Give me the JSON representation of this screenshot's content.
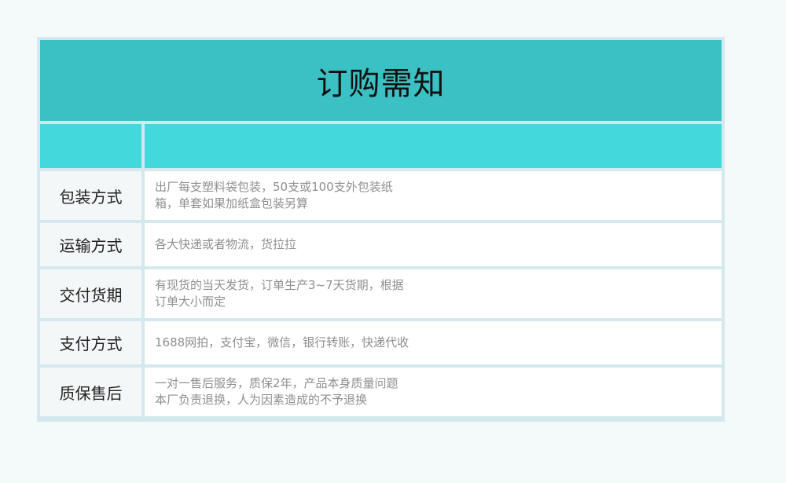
{
  "title": "订购需知",
  "rows": [
    {
      "label": "包装方式",
      "lines": [
        "出厂每支塑料袋包装，50支或100支外包装纸",
        "箱，单套如果加纸盒包装另算"
      ]
    },
    {
      "label": "运输方式",
      "lines": [
        "各大快递或者物流，货拉拉"
      ]
    },
    {
      "label": "交付货期",
      "lines": [
        "有现货的当天发货，订单生产3~7天货期，根据",
        "订单大小而定"
      ]
    },
    {
      "label": "支付方式",
      "lines": [
        "1688网拍，支付宝，微信，银行转账，快递代收"
      ]
    },
    {
      "label": "质保售后",
      "lines": [
        "一对一售后服务，质保2年，产品本身质量问题",
        "本厂负责退换，人为因素造成的不予退换"
      ]
    }
  ],
  "colors": {
    "header": "#3bc0c3",
    "subheader": "#42d8dc",
    "border": "#d3e9ee"
  }
}
